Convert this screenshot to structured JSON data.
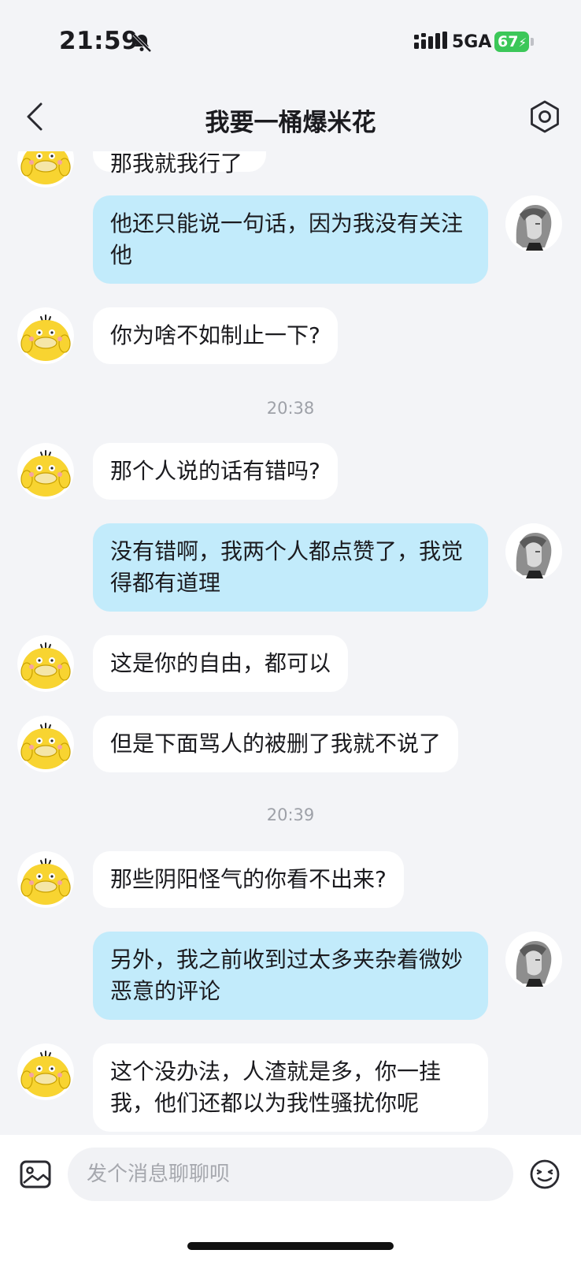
{
  "status_bar": {
    "time": "21:59",
    "network": "5GA",
    "battery": "67"
  },
  "nav": {
    "title": "我要一桶爆米花"
  },
  "chat": {
    "messages": [
      {
        "side": "left",
        "text": "那我就我行了"
      },
      {
        "side": "right",
        "text": "他还只能说一句话，因为我没有关注他"
      },
      {
        "side": "left",
        "text": "你为啥不如制止一下?"
      },
      {
        "timestamp": "20:38"
      },
      {
        "side": "left",
        "text": "那个人说的话有错吗?"
      },
      {
        "side": "right",
        "text": "没有错啊，我两个人都点赞了，我觉得都有道理"
      },
      {
        "side": "left",
        "text": "这是你的自由，都可以"
      },
      {
        "side": "left",
        "text": "但是下面骂人的被删了我就不说了"
      },
      {
        "timestamp": "20:39"
      },
      {
        "side": "left",
        "text": "那些阴阳怪气的你看不出来?"
      },
      {
        "side": "right",
        "text": "另外，我之前收到过太多夹杂着微妙恶意的评论"
      },
      {
        "side": "left",
        "text": "这个没办法，人渣就是多，你一挂我，他们还都以为我性骚扰你呢"
      }
    ]
  },
  "input_bar": {
    "placeholder": "发个消息聊聊呗"
  },
  "icons": {
    "back": "chevron-left-icon",
    "settings": "settings-icon",
    "mute": "bell-slash-icon",
    "image": "image-icon",
    "emoji": "emoji-icon"
  },
  "colors": {
    "self_bubble": "#c2ebfb",
    "other_bubble": "#ffffff",
    "background": "#f3f4f7",
    "battery": "#3cc759"
  }
}
